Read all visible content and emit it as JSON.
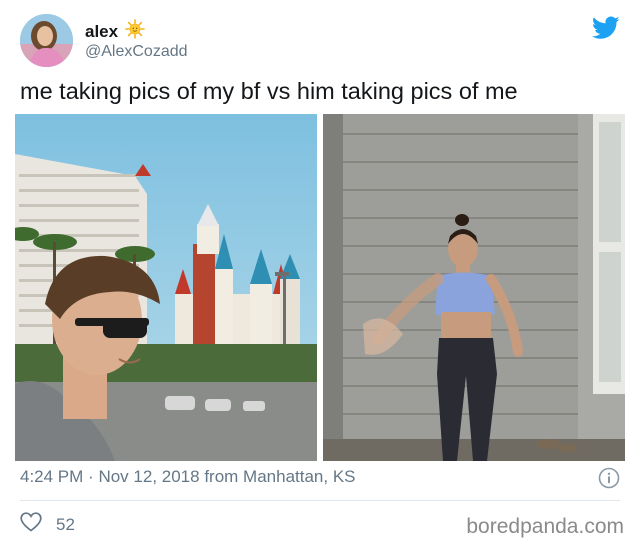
{
  "user": {
    "display_name": "alex",
    "emoji": "sun-emoji",
    "handle": "@AlexCozadd"
  },
  "tweet": {
    "text": "me taking pics of my bf vs him taking pics of me",
    "time": "4:24 PM",
    "date": "Nov 12, 2018",
    "location_text": "from Manhattan, KS",
    "separator": "·",
    "likes": "52"
  },
  "icons": {
    "brand": "twitter-bird-icon",
    "info": "info-icon",
    "like": "heart-icon"
  },
  "colors": {
    "twitter_blue": "#1da1f2",
    "secondary_text": "#657786",
    "divider": "#e1e8ed"
  },
  "watermark": "boredpanda.com"
}
